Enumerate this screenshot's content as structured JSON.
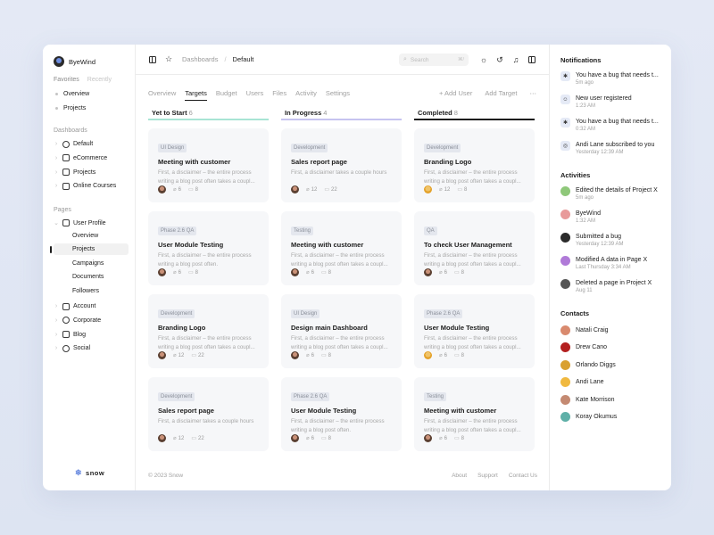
{
  "brand": {
    "name": "ByeWind"
  },
  "sidebar": {
    "tabs": [
      "Favorites",
      "Recently"
    ],
    "favorites": [
      "Overview",
      "Projects"
    ],
    "dashboards_label": "Dashboards",
    "dashboards": [
      {
        "label": "Default",
        "icon": "chart-pie-icon"
      },
      {
        "label": "eCommerce",
        "icon": "shopping-bag-icon"
      },
      {
        "label": "Projects",
        "icon": "folder-icon"
      },
      {
        "label": "Online Courses",
        "icon": "book-open-icon"
      }
    ],
    "pages_label": "Pages",
    "user_profile": "User Profile",
    "profile_items": [
      "Overview",
      "Projects",
      "Campaigns",
      "Documents",
      "Followers"
    ],
    "other_pages": [
      {
        "label": "Account",
        "icon": "id-card-icon"
      },
      {
        "label": "Corporate",
        "icon": "users-icon"
      },
      {
        "label": "Blog",
        "icon": "notebook-icon"
      },
      {
        "label": "Social",
        "icon": "chat-icon"
      }
    ],
    "logo_text": "snow"
  },
  "header": {
    "crumb_parent": "Dashboards",
    "crumb_sep": "/",
    "crumb_current": "Default",
    "search_placeholder": "Search",
    "search_shortcut": "⌘/"
  },
  "tabs": [
    "Overview",
    "Targets",
    "Budget",
    "Users",
    "Files",
    "Activity",
    "Settings"
  ],
  "tab_actions": {
    "add_user": "+ Add User",
    "add_target": "Add Target",
    "more": "⋯"
  },
  "columns": [
    {
      "title": "Yet to Start",
      "count": "6",
      "color": "#a8e4d4",
      "cards": [
        {
          "tag": "UI Design",
          "title": "Meeting with customer",
          "desc": "First, a disclaimer – the entire process writing a blog post often takes a coupl...",
          "links": "6",
          "comments": "8"
        },
        {
          "tag": "Phase 2.6 QA",
          "title": "User Module Testing",
          "desc": "First, a disclaimer – the entire process writing a blog post often.",
          "links": "6",
          "comments": "8"
        },
        {
          "tag": "Development",
          "title": "Branding Logo",
          "desc": "First, a disclaimer – the entire process writing a blog post often takes a coupl...",
          "links": "12",
          "comments": "22"
        },
        {
          "tag": "Development",
          "title": "Sales report page",
          "desc": "First, a disclaimer takes a couple hours",
          "links": "12",
          "comments": "22"
        }
      ]
    },
    {
      "title": "In Progress",
      "count": "4",
      "color": "#c6c3f0",
      "cards": [
        {
          "tag": "Development",
          "title": "Sales report page",
          "desc": "First, a disclaimer takes a couple hours",
          "links": "12",
          "comments": "22"
        },
        {
          "tag": "Testing",
          "title": "Meeting with customer",
          "desc": "First, a disclaimer – the entire process writing a blog post often takes a coupl...",
          "links": "6",
          "comments": "8"
        },
        {
          "tag": "UI Design",
          "title": "Design main Dashboard",
          "desc": "First, a disclaimer – the entire process writing a blog post often takes a coupl...",
          "links": "6",
          "comments": "8"
        },
        {
          "tag": "Phase 2.6 QA",
          "title": "User Module Testing",
          "desc": "First, a disclaimer – the entire process writing a blog post often.",
          "links": "6",
          "comments": "8"
        }
      ]
    },
    {
      "title": "Completed",
      "count": "8",
      "color": "#1c1c1c",
      "cards": [
        {
          "tag": "Development",
          "title": "Branding Logo",
          "desc": "First, a disclaimer – the entire process writing a blog post often takes a coupl...",
          "links": "12",
          "comments": "8"
        },
        {
          "tag": "QA",
          "title": "To check User Management",
          "desc": "First, a disclaimer – the entire process writing a blog post often takes a coupl...",
          "links": "6",
          "comments": "8"
        },
        {
          "tag": "Phase 2.6 QA",
          "title": "User Module Testing",
          "desc": "First, a disclaimer – the entire process writing a blog post often takes a coupl...",
          "links": "6",
          "comments": "8"
        },
        {
          "tag": "Testing",
          "title": "Meeting with customer",
          "desc": "First, a disclaimer – the entire process writing a blog post often takes a coupl...",
          "links": "6",
          "comments": "8"
        }
      ]
    }
  ],
  "footer": {
    "copyright": "© 2023 Snow",
    "links": [
      "About",
      "Support",
      "Contact Us"
    ]
  },
  "notifications": {
    "title": "Notifications",
    "items": [
      {
        "text": "You have a bug that needs t...",
        "time": "5m ago",
        "icon": "bug-icon"
      },
      {
        "text": "New user registered",
        "time": "1:23 AM",
        "icon": "user-icon"
      },
      {
        "text": "You have a bug that needs t...",
        "time": "0:32 AM",
        "icon": "bug-icon"
      },
      {
        "text": "Andi Lane subscribed to you",
        "time": "Yesterday 12:39 AM",
        "icon": "broadcast-icon"
      }
    ]
  },
  "activities": {
    "title": "Activities",
    "items": [
      {
        "text": "Edited the details of Project X",
        "time": "5m ago",
        "color": "#8fc87a"
      },
      {
        "text": "ByeWind",
        "time": "1:32 AM",
        "color": "#e89a9a"
      },
      {
        "text": "Submitted a bug",
        "time": "Yesterday 12:39 AM",
        "color": "#2b2b2b"
      },
      {
        "text": "Modified A data in Page X",
        "time": "Last Thursday 3:34 AM",
        "color": "#b07ad8"
      },
      {
        "text": "Deleted a page in Project X",
        "time": "Aug 11",
        "color": "#555555"
      }
    ]
  },
  "contacts": {
    "title": "Contacts",
    "items": [
      {
        "name": "Natali Craig",
        "color": "#d98a6e"
      },
      {
        "name": "Drew Cano",
        "color": "#b32020"
      },
      {
        "name": "Orlando Diggs",
        "color": "#d9a030"
      },
      {
        "name": "Andi Lane",
        "color": "#f0b940"
      },
      {
        "name": "Kate Morrison",
        "color": "#c48a72"
      },
      {
        "name": "Koray Okumus",
        "color": "#5fb0a8"
      }
    ]
  }
}
